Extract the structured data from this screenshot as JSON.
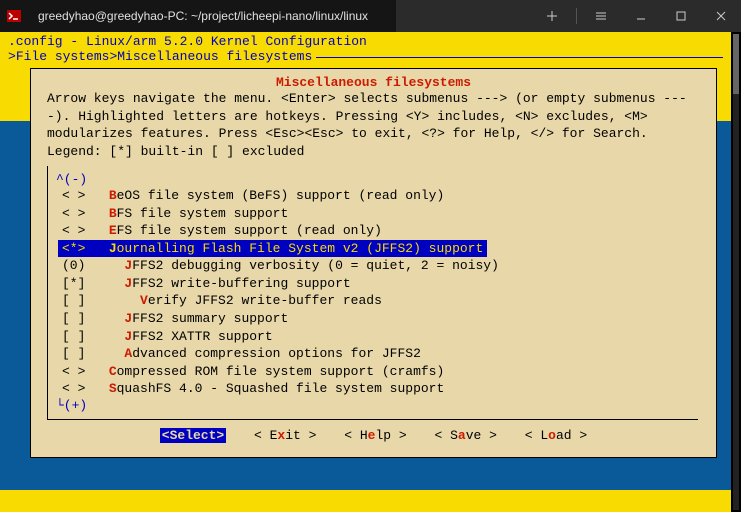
{
  "titlebar": {
    "tab_title": "greedyhao@greedyhao-PC: ~/project/licheepi-nano/linux/linux",
    "prompt_icon": ">_"
  },
  "header": {
    "config_line": ".config - Linux/arm 5.2.0 Kernel Configuration",
    "crumb_prefix": "> ",
    "crumb1": "File systems",
    "crumb_sep": " > ",
    "crumb2": "Miscellaneous filesystems"
  },
  "panel": {
    "title": "Miscellaneous filesystems",
    "help": "Arrow keys navigate the menu.  <Enter> selects submenus ---> (or empty submenus ----).  Highlighted letters are hotkeys.  Pressing <Y> includes, <N> excludes, <M> modularizes features.  Press <Esc><Esc> to exit, <?> for Help, </> for Search.  Legend: [*] built-in  [ ] excluded",
    "scroll_up": "^(-)",
    "scroll_down": "└(+)",
    "items": [
      {
        "mark": "< >",
        "hot": "B",
        "rest": "eOS file system (BeFS) support (read only)",
        "indent": 3,
        "sel": false
      },
      {
        "mark": "< >",
        "hot": "B",
        "rest": "FS file system support",
        "indent": 3,
        "sel": false
      },
      {
        "mark": "< >",
        "hot": "E",
        "rest": "FS file system support (read only)",
        "indent": 3,
        "sel": false
      },
      {
        "mark": "<*>",
        "hot": "J",
        "rest": "ournalling Flash File System v2 (JFFS2) support",
        "indent": 3,
        "sel": true
      },
      {
        "mark": "(0)",
        "hot": "J",
        "rest": "FFS2 debugging verbosity (0 = quiet, 2 = noisy)",
        "indent": 5,
        "sel": false
      },
      {
        "mark": "[*]",
        "hot": "J",
        "rest": "FFS2 write-buffering support",
        "indent": 5,
        "sel": false
      },
      {
        "mark": "[ ]",
        "hot": "V",
        "rest": "erify JFFS2 write-buffer reads",
        "indent": 7,
        "sel": false
      },
      {
        "mark": "[ ]",
        "hot": "J",
        "rest": "FFS2 summary support",
        "indent": 5,
        "sel": false
      },
      {
        "mark": "[ ]",
        "hot": "J",
        "rest": "FFS2 XATTR support",
        "indent": 5,
        "sel": false
      },
      {
        "mark": "[ ]",
        "hot": "A",
        "rest": "dvanced compression options for JFFS2",
        "indent": 5,
        "sel": false
      },
      {
        "mark": "< >",
        "hot": "C",
        "rest": "ompressed ROM file system support (cramfs)",
        "indent": 3,
        "sel": false
      },
      {
        "mark": "< >",
        "hot": "S",
        "rest": "quashFS 4.0 - Squashed file system support",
        "indent": 3,
        "sel": false
      }
    ],
    "buttons": {
      "select": {
        "pre": "<S",
        "hot": "",
        "mid": "elect>",
        "sel": true
      },
      "exit": {
        "pre": "< E",
        "hot": "x",
        "mid": "it >"
      },
      "help": {
        "pre": "< H",
        "hot": "e",
        "mid": "lp >"
      },
      "save": {
        "pre": "< S",
        "hot": "a",
        "mid": "ve >"
      },
      "load": {
        "pre": "< L",
        "hot": "o",
        "mid": "ad >"
      }
    }
  }
}
